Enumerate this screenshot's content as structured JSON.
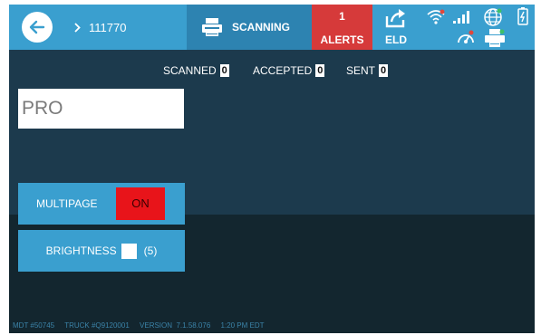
{
  "header": {
    "load_id": "111770",
    "scan_label": "SCANNING",
    "alerts_count": "1",
    "alerts_label": "ALERTS",
    "eld_label": "ELD"
  },
  "status_icons": [
    "wifi-icon",
    "signal-bars-icon",
    "globe-icon",
    "battery-icon",
    "speed-gauge-icon",
    "printer-icon"
  ],
  "counters": {
    "scanned_label": "SCANNED",
    "scanned_value": "0",
    "accepted_label": "ACCEPTED",
    "accepted_value": "0",
    "sent_label": "SENT",
    "sent_value": "0"
  },
  "pro_input": {
    "placeholder": "PRO",
    "value": ""
  },
  "multipage": {
    "label": "MULTIPAGE",
    "toggle": "ON"
  },
  "brightness": {
    "label": "BRIGHTNESS",
    "value": "(5)"
  },
  "footer": {
    "mdt": "MDT #50745",
    "truck": "TRUCK #Q9120001",
    "version": "VERSION  7.1.58.076",
    "time": "1:20 PM EDT"
  },
  "colors": {
    "topbar": "#3a9fcf",
    "scan_tab": "#2d83b1",
    "alerts": "#d63a3a",
    "body": "#1c3a4d",
    "toggle_on": "#e8141a"
  }
}
